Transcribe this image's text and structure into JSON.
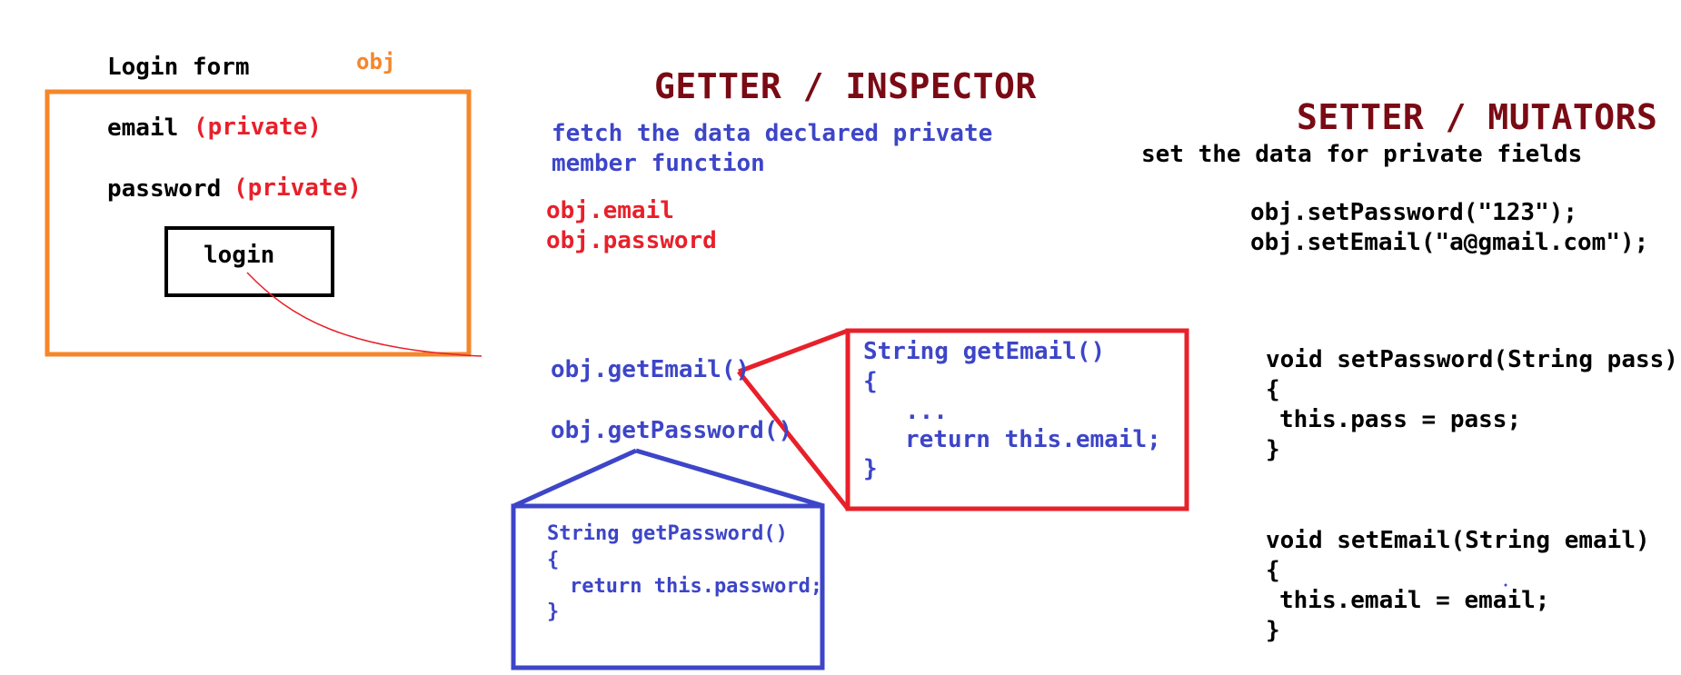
{
  "login_form": {
    "title": "Login form",
    "object_label": "obj",
    "email_label": "email",
    "email_private": "(private)",
    "password_label": "password",
    "password_private": "(private)",
    "login_button": "login"
  },
  "getter": {
    "heading": "GETTER / INSPECTOR",
    "description_line1": "fetch the data declared private",
    "description_line2": "member function",
    "field_access_line1": "obj.email",
    "field_access_line2": "obj.password",
    "call_email": "obj.getEmail()",
    "call_password": "obj.getPassword()",
    "email_method": {
      "line1": "String getEmail()",
      "line2": "{",
      "line3": "...",
      "line4": "return this.email;",
      "line5": "}"
    },
    "password_method": {
      "line1": "String getPassword()",
      "line2": "{",
      "line3": "return this.password;",
      "line4": "}"
    }
  },
  "setter": {
    "heading": "SETTER / MUTATORS",
    "description": "set the data for private fields",
    "call_password": "obj.setPassword(\"123\");",
    "call_email": "obj.setEmail(\"a@gmail.com\");",
    "password_method": {
      "line1": "void setPassword(String pass)",
      "line2": "{",
      "line3": "this.pass = pass;",
      "line4": "}"
    },
    "email_method": {
      "line1": "void setEmail(String email)",
      "line2": "{",
      "line3": "this.email = email;",
      "line4": "}"
    }
  },
  "colors": {
    "orange": "#f5862a",
    "red": "#e8202a",
    "blue": "#3d45c8",
    "heading": "#7a0a14",
    "black": "#000000"
  }
}
